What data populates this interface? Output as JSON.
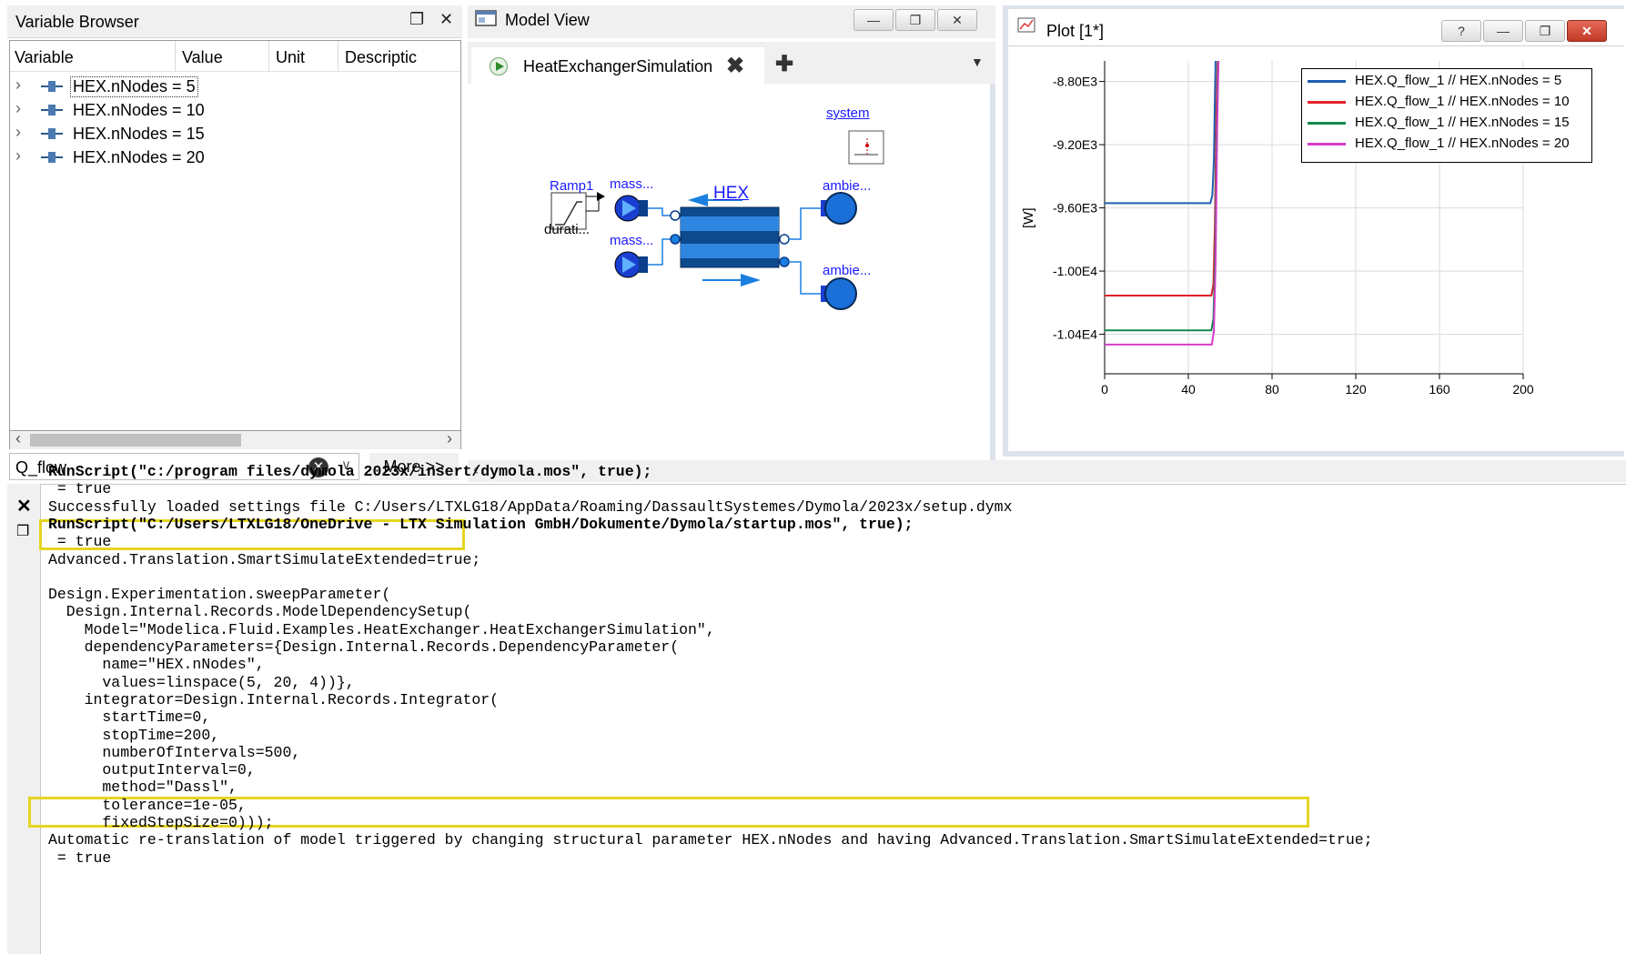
{
  "variable_browser": {
    "title": "Variable Browser",
    "columns": [
      "Variable",
      "Value",
      "Unit",
      "Descriptic"
    ],
    "rows": [
      {
        "label": "HEX.nNodes = 5"
      },
      {
        "label": "HEX.nNodes = 10"
      },
      {
        "label": "HEX.nNodes = 15"
      },
      {
        "label": "HEX.nNodes = 20"
      }
    ],
    "filter": {
      "value": "Q_flow"
    },
    "more_label": "More >>",
    "float_icon": "float-icon",
    "close_icon": "close-icon"
  },
  "model_view": {
    "title": "Model View",
    "tab": {
      "label": "HeatExchangerSimulation"
    },
    "components": {
      "system": "system",
      "ramp": "Ramp1",
      "duration": "durati...",
      "mass1": "mass...",
      "mass2": "mass...",
      "hex": "HEX",
      "ambient1": "ambie...",
      "ambient2": "ambie..."
    }
  },
  "plot": {
    "title": "Plot [1*]",
    "help_label": "?",
    "y_unit_label": "[W]",
    "colors": {
      "blue": "#1f5fb0",
      "red": "#e3212b",
      "green": "#138a4a",
      "magenta": "#d33cc8"
    }
  },
  "chart_data": {
    "type": "line",
    "title": "",
    "xlabel": "",
    "ylabel": "[W]",
    "xlim": [
      0,
      200
    ],
    "ylim": [
      -10650,
      -8670
    ],
    "x_ticks": [
      "0",
      "40",
      "80",
      "120",
      "160",
      "200"
    ],
    "y_ticks": [
      "-8.80E3",
      "-9.20E3",
      "-9.60E3",
      "-1.00E4",
      "-1.04E4"
    ],
    "legend_placement": "top-right",
    "series": [
      {
        "name": "HEX.Q_flow_1 // HEX.nNodes = 5",
        "color": "#1f5fb0",
        "points": [
          [
            0,
            -9570
          ],
          [
            50.5,
            -9570
          ],
          [
            51.5,
            -9520
          ],
          [
            52.2,
            -9300
          ],
          [
            52.7,
            -8900
          ],
          [
            53,
            -8660
          ]
        ]
      },
      {
        "name": "HEX.Q_flow_1 // HEX.nNodes = 10",
        "color": "#e3212b",
        "points": [
          [
            0,
            -10155
          ],
          [
            51,
            -10155
          ],
          [
            52,
            -10080
          ],
          [
            52.7,
            -9700
          ],
          [
            53.4,
            -9000
          ],
          [
            54,
            -8660
          ]
        ]
      },
      {
        "name": "HEX.Q_flow_1 // HEX.nNodes = 15",
        "color": "#138a4a",
        "points": [
          [
            0,
            -10375
          ],
          [
            51,
            -10375
          ],
          [
            52,
            -10300
          ],
          [
            52.8,
            -9900
          ],
          [
            53.6,
            -9100
          ],
          [
            54.2,
            -8660
          ]
        ]
      },
      {
        "name": "HEX.Q_flow_1 // HEX.nNodes = 20",
        "color": "#d33cc8",
        "points": [
          [
            0,
            -10465
          ],
          [
            51.2,
            -10465
          ],
          [
            52.2,
            -10380
          ],
          [
            53,
            -9950
          ],
          [
            53.8,
            -9100
          ],
          [
            54.4,
            -8660
          ]
        ]
      }
    ]
  },
  "command": {
    "lines": [
      {
        "text": "RunScript(\"c:/program files/dymola 2023x/insert/dymola.mos\", true);",
        "bold": true
      },
      {
        "text": " = true",
        "bold": false
      },
      {
        "text": "Successfully loaded settings file C:/Users/LTXLG18/AppData/Roaming/DassaultSystemes/Dymola/2023x/setup.dymx",
        "bold": false
      },
      {
        "text": "RunScript(\"C:/Users/LTXLG18/OneDrive - LTX Simulation GmbH/Dokumente/Dymola/startup.mos\", true);",
        "bold": true
      },
      {
        "text": " = true",
        "bold": false
      },
      {
        "text": "Advanced.Translation.SmartSimulateExtended=true;",
        "bold": false
      },
      {
        "text": "",
        "bold": false
      },
      {
        "text": "Design.Experimentation.sweepParameter(",
        "bold": false
      },
      {
        "text": "  Design.Internal.Records.ModelDependencySetup(",
        "bold": false
      },
      {
        "text": "    Model=\"Modelica.Fluid.Examples.HeatExchanger.HeatExchangerSimulation\",",
        "bold": false
      },
      {
        "text": "    dependencyParameters={Design.Internal.Records.DependencyParameter(",
        "bold": false
      },
      {
        "text": "      name=\"HEX.nNodes\",",
        "bold": false
      },
      {
        "text": "      values=linspace(5, 20, 4))},",
        "bold": false
      },
      {
        "text": "    integrator=Design.Internal.Records.Integrator(",
        "bold": false
      },
      {
        "text": "      startTime=0,",
        "bold": false
      },
      {
        "text": "      stopTime=200,",
        "bold": false
      },
      {
        "text": "      numberOfIntervals=500,",
        "bold": false
      },
      {
        "text": "      outputInterval=0,",
        "bold": false
      },
      {
        "text": "      method=\"Dassl\",",
        "bold": false
      },
      {
        "text": "      tolerance=1e-05,",
        "bold": false
      },
      {
        "text": "      fixedStepSize=0)));",
        "bold": false
      },
      {
        "text": "Automatic re-translation of model triggered by changing structural parameter HEX.nNodes and having Advanced.Translation.SmartSimulateExtended=true;",
        "bold": false
      },
      {
        "text": " = true",
        "bold": false
      }
    ],
    "highlight_color": "#e5d51f"
  }
}
